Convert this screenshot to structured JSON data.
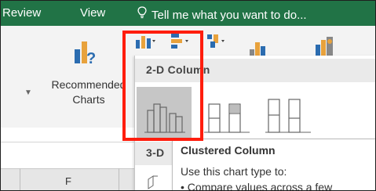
{
  "ribbon_tabs": {
    "review": "Review",
    "view": "View",
    "tell_me": "Tell me what you want to do..."
  },
  "ribbon": {
    "recommended_charts_line1": "Recommended",
    "recommended_charts_line2": "Charts"
  },
  "dropdown": {
    "section_2d": "2-D Column",
    "section_3d": "3-D",
    "gallery_items": [
      "clustered-column",
      "stacked-column",
      "100-stacked-column"
    ]
  },
  "tooltip": {
    "title": "Clustered Column",
    "line1": "Use this chart type to:",
    "bullet": "• Compare values across a few"
  },
  "sheet": {
    "column_letter": "F"
  },
  "colors": {
    "ribbon_green": "#217346",
    "highlight_red": "#ff1d0d"
  },
  "icons": [
    "lightbulb-icon",
    "recommended-charts-icon",
    "column-chart-icon",
    "bar-chart-icon",
    "hierarchy-chart-icon",
    "waterfall-chart-icon",
    "map-chart-icon"
  ]
}
